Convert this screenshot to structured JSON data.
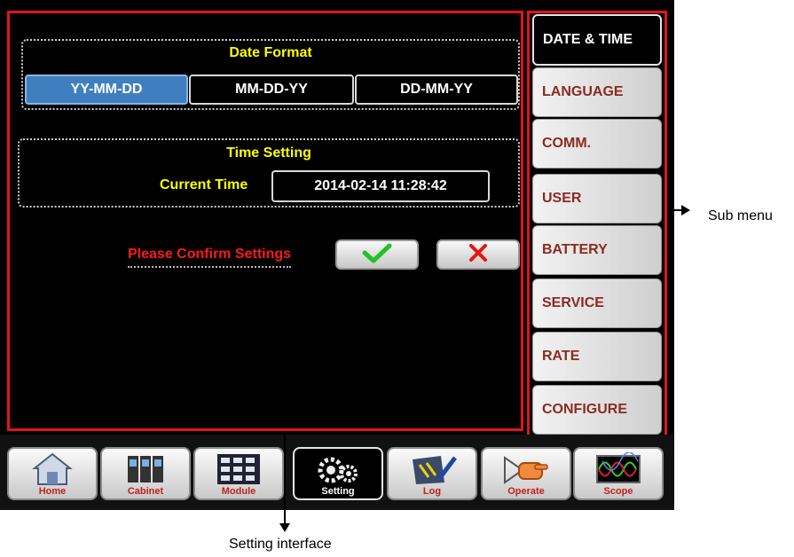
{
  "date_format": {
    "title": "Date Format",
    "options": [
      "YY-MM-DD",
      "MM-DD-YY",
      "DD-MM-YY"
    ],
    "selected": "YY-MM-DD"
  },
  "time_setting": {
    "title": "Time Setting",
    "current_time_label": "Current Time",
    "current_time_value": "2014-02-14  11:28:42"
  },
  "confirm": {
    "text": "Please Confirm Settings",
    "ok_icon": "checkmark-icon",
    "cancel_icon": "x-icon",
    "ok_color": "#22c02a",
    "cancel_color": "#e81313"
  },
  "sub_menu": {
    "items": [
      "DATE & TIME",
      "LANGUAGE",
      "COMM.",
      "USER",
      "BATTERY",
      "SERVICE",
      "RATE",
      "CONFIGURE"
    ],
    "active": "DATE & TIME"
  },
  "bottom_nav": {
    "items": [
      {
        "label": "Home",
        "icon": "home-icon"
      },
      {
        "label": "Cabinet",
        "icon": "cabinet-icon"
      },
      {
        "label": "Module",
        "icon": "module-icon"
      },
      {
        "label": "Setting",
        "icon": "gears-icon"
      },
      {
        "label": "Log",
        "icon": "log-icon"
      },
      {
        "label": "Operate",
        "icon": "pointing-hand-icon"
      },
      {
        "label": "Scope",
        "icon": "scope-icon"
      }
    ],
    "active": "Setting"
  },
  "annotations": {
    "sub_menu": "Sub menu",
    "setting_interface": "Setting interface"
  },
  "colors": {
    "highlight_outline": "#e0141c",
    "selected_option": "#3f7fc0",
    "group_title": "#ffff00"
  }
}
